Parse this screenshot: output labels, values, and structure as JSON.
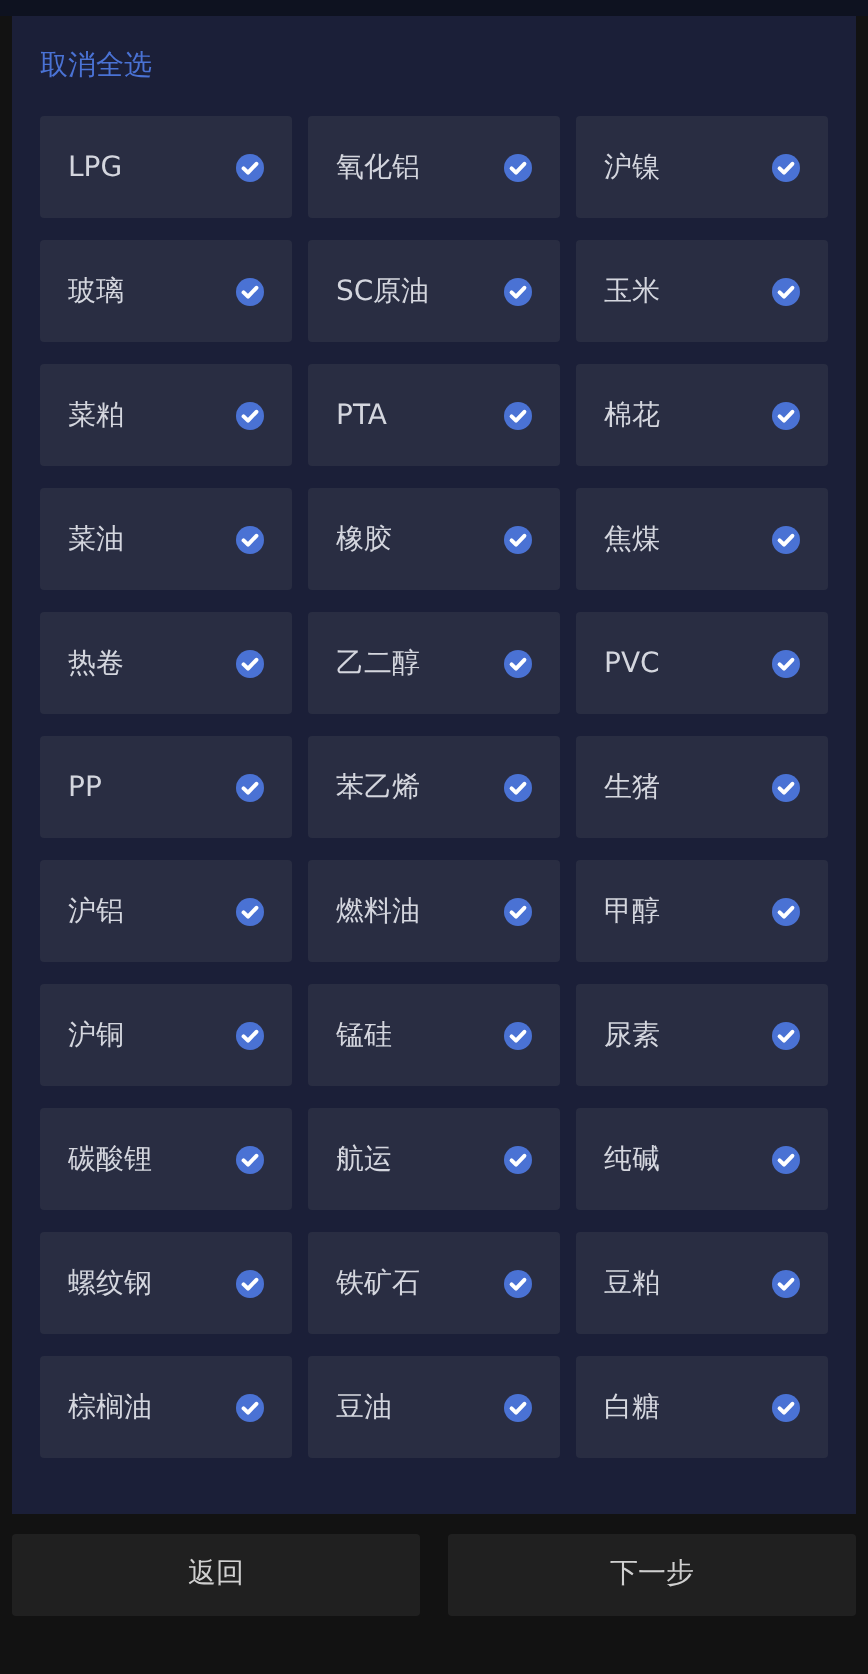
{
  "header": {
    "deselect_all": "取消全选"
  },
  "items": [
    {
      "label": "LPG",
      "selected": true
    },
    {
      "label": "氧化铝",
      "selected": true
    },
    {
      "label": "沪镍",
      "selected": true
    },
    {
      "label": "玻璃",
      "selected": true
    },
    {
      "label": "SC原油",
      "selected": true
    },
    {
      "label": "玉米",
      "selected": true
    },
    {
      "label": "菜粕",
      "selected": true
    },
    {
      "label": "PTA",
      "selected": true
    },
    {
      "label": "棉花",
      "selected": true
    },
    {
      "label": "菜油",
      "selected": true
    },
    {
      "label": "橡胶",
      "selected": true
    },
    {
      "label": "焦煤",
      "selected": true
    },
    {
      "label": "热卷",
      "selected": true
    },
    {
      "label": "乙二醇",
      "selected": true
    },
    {
      "label": "PVC",
      "selected": true
    },
    {
      "label": "PP",
      "selected": true
    },
    {
      "label": "苯乙烯",
      "selected": true
    },
    {
      "label": "生猪",
      "selected": true
    },
    {
      "label": "沪铝",
      "selected": true
    },
    {
      "label": "燃料油",
      "selected": true
    },
    {
      "label": "甲醇",
      "selected": true
    },
    {
      "label": "沪铜",
      "selected": true
    },
    {
      "label": "锰硅",
      "selected": true
    },
    {
      "label": "尿素",
      "selected": true
    },
    {
      "label": "碳酸锂",
      "selected": true
    },
    {
      "label": "航运",
      "selected": true
    },
    {
      "label": "纯碱",
      "selected": true
    },
    {
      "label": "螺纹钢",
      "selected": true
    },
    {
      "label": "铁矿石",
      "selected": true
    },
    {
      "label": "豆粕",
      "selected": true
    },
    {
      "label": "棕榈油",
      "selected": true
    },
    {
      "label": "豆油",
      "selected": true
    },
    {
      "label": "白糖",
      "selected": true
    }
  ],
  "buttons": {
    "back": "返回",
    "next": "下一步"
  }
}
